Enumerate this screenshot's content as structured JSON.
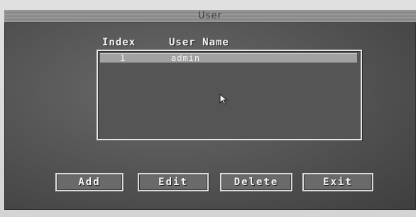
{
  "window": {
    "title": "User"
  },
  "list": {
    "columns": {
      "index": "Index",
      "username": "User Name"
    },
    "rows": [
      {
        "index": "1",
        "username": "admin",
        "selected": true
      }
    ]
  },
  "buttons": {
    "add": "Add",
    "edit": "Edit",
    "delete": "Delete",
    "exit": "Exit"
  },
  "colors": {
    "panel": "#525252",
    "selection": "#a2a2a2",
    "text": "#f0f0f0"
  },
  "icons": {
    "pointer": "mouse-pointer-icon"
  }
}
